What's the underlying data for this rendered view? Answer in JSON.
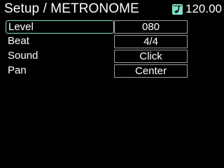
{
  "header": {
    "title": "Setup / METRONOME",
    "tempo": "120.00",
    "tempo_icon": "quarter-note-icon",
    "accent_color": "#7fe0c8"
  },
  "params": [
    {
      "label": "Level",
      "value": "080",
      "selected": true
    },
    {
      "label": "Beat",
      "value": "4/4",
      "selected": false
    },
    {
      "label": "Sound",
      "value": "Click",
      "selected": false
    },
    {
      "label": "Pan",
      "value": "Center",
      "selected": false
    }
  ]
}
